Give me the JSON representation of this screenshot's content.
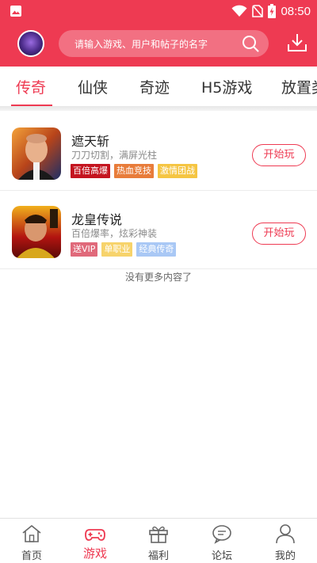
{
  "status_bar": {
    "time": "08:50"
  },
  "header": {
    "search_placeholder": "请输入游戏、用户和帖子的名字",
    "brand_color": "#ee3a52"
  },
  "tabs": [
    "传奇",
    "仙侠",
    "奇迹",
    "H5游戏",
    "放置类"
  ],
  "active_tab": "传奇",
  "games": [
    {
      "title": "遮天斩",
      "desc": "刀刀切割，满屏光柱",
      "tags": [
        {
          "label": "百倍高爆",
          "color": "#c4141f"
        },
        {
          "label": "热血竞技",
          "color": "#e87c3a"
        },
        {
          "label": "激情团战",
          "color": "#f5c542"
        }
      ],
      "button": "开始玩"
    },
    {
      "title": "龙皇传说",
      "desc": "百倍爆率，炫彩神装",
      "tags": [
        {
          "label": "送VIP",
          "color": "#e0697a"
        },
        {
          "label": "单职业",
          "color": "#f7d36b"
        },
        {
          "label": "经典传奇",
          "color": "#a9c8f5"
        }
      ],
      "button": "开始玩"
    }
  ],
  "no_more_text": "没有更多内容了",
  "bottom_nav": [
    {
      "label": "首页",
      "icon": "home-icon"
    },
    {
      "label": "游戏",
      "icon": "gamepad-icon"
    },
    {
      "label": "福利",
      "icon": "gift-icon"
    },
    {
      "label": "论坛",
      "icon": "chat-icon"
    },
    {
      "label": "我的",
      "icon": "user-icon"
    }
  ],
  "active_nav": "游戏"
}
